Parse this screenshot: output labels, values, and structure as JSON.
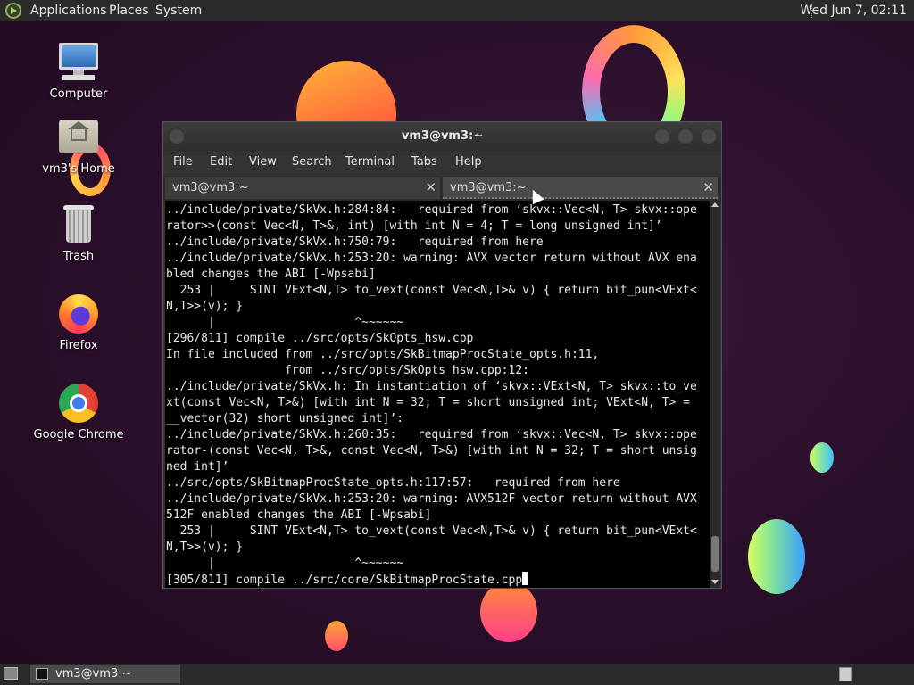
{
  "top_panel": {
    "menus": [
      "Applications",
      "Places",
      "System"
    ],
    "clock": "Wed Jun  7, 02:11"
  },
  "desktop_icons": [
    {
      "label": "Computer",
      "icon": "computer-icon"
    },
    {
      "label": "vm3's Home",
      "icon": "home-folder-icon"
    },
    {
      "label": "Trash",
      "icon": "trash-icon"
    },
    {
      "label": "Firefox",
      "icon": "firefox-icon"
    },
    {
      "label": "Google Chrome",
      "icon": "chrome-icon"
    }
  ],
  "window": {
    "title": "vm3@vm3:~",
    "menu": [
      "File",
      "Edit",
      "View",
      "Search",
      "Terminal",
      "Tabs",
      "Help"
    ],
    "tabs": [
      "vm3@vm3:~",
      "vm3@vm3:~"
    ],
    "close_glyph": "✕"
  },
  "terminal": {
    "lines": [
      "../include/private/SkVx.h:284:84:   required from ‘skvx::Vec<N, T> skvx::ope",
      "rator>>(const Vec<N, T>&, int) [with int N = 4; T = long unsigned int]’",
      "../include/private/SkVx.h:750:79:   required from here",
      "../include/private/SkVx.h:253:20: warning: AVX vector return without AVX ena",
      "bled changes the ABI [-Wpsabi]",
      "  253 |     SINT VExt<N,T> to_vext(const Vec<N,T>& v) { return bit_pun<VExt<",
      "N,T>>(v); }",
      "      |                    ^~~~~~~",
      "[296/811] compile ../src/opts/SkOpts_hsw.cpp",
      "In file included from ../src/opts/SkBitmapProcState_opts.h:11,",
      "                 from ../src/opts/SkOpts_hsw.cpp:12:",
      "../include/private/SkVx.h: In instantiation of ‘skvx::VExt<N, T> skvx::to_ve",
      "xt(const Vec<N, T>&) [with int N = 32; T = short unsigned int; VExt<N, T> =",
      "__vector(32) short unsigned int]’:",
      "../include/private/SkVx.h:260:35:   required from ‘skvx::Vec<N, T> skvx::ope",
      "rator-(const Vec<N, T>&, const Vec<N, T>&) [with int N = 32; T = short unsig",
      "ned int]’",
      "../src/opts/SkBitmapProcState_opts.h:117:57:   required from here",
      "../include/private/SkVx.h:253:20: warning: AVX512F vector return without AVX",
      "512F enabled changes the ABI [-Wpsabi]",
      "  253 |     SINT VExt<N,T> to_vext(const Vec<N,T>& v) { return bit_pun<VExt<",
      "N,T>>(v); }",
      "      |                    ^~~~~~~",
      "[305/811] compile ../src/core/SkBitmapProcState.cpp"
    ]
  },
  "bottom_panel": {
    "task_label": "vm3@vm3:~"
  }
}
